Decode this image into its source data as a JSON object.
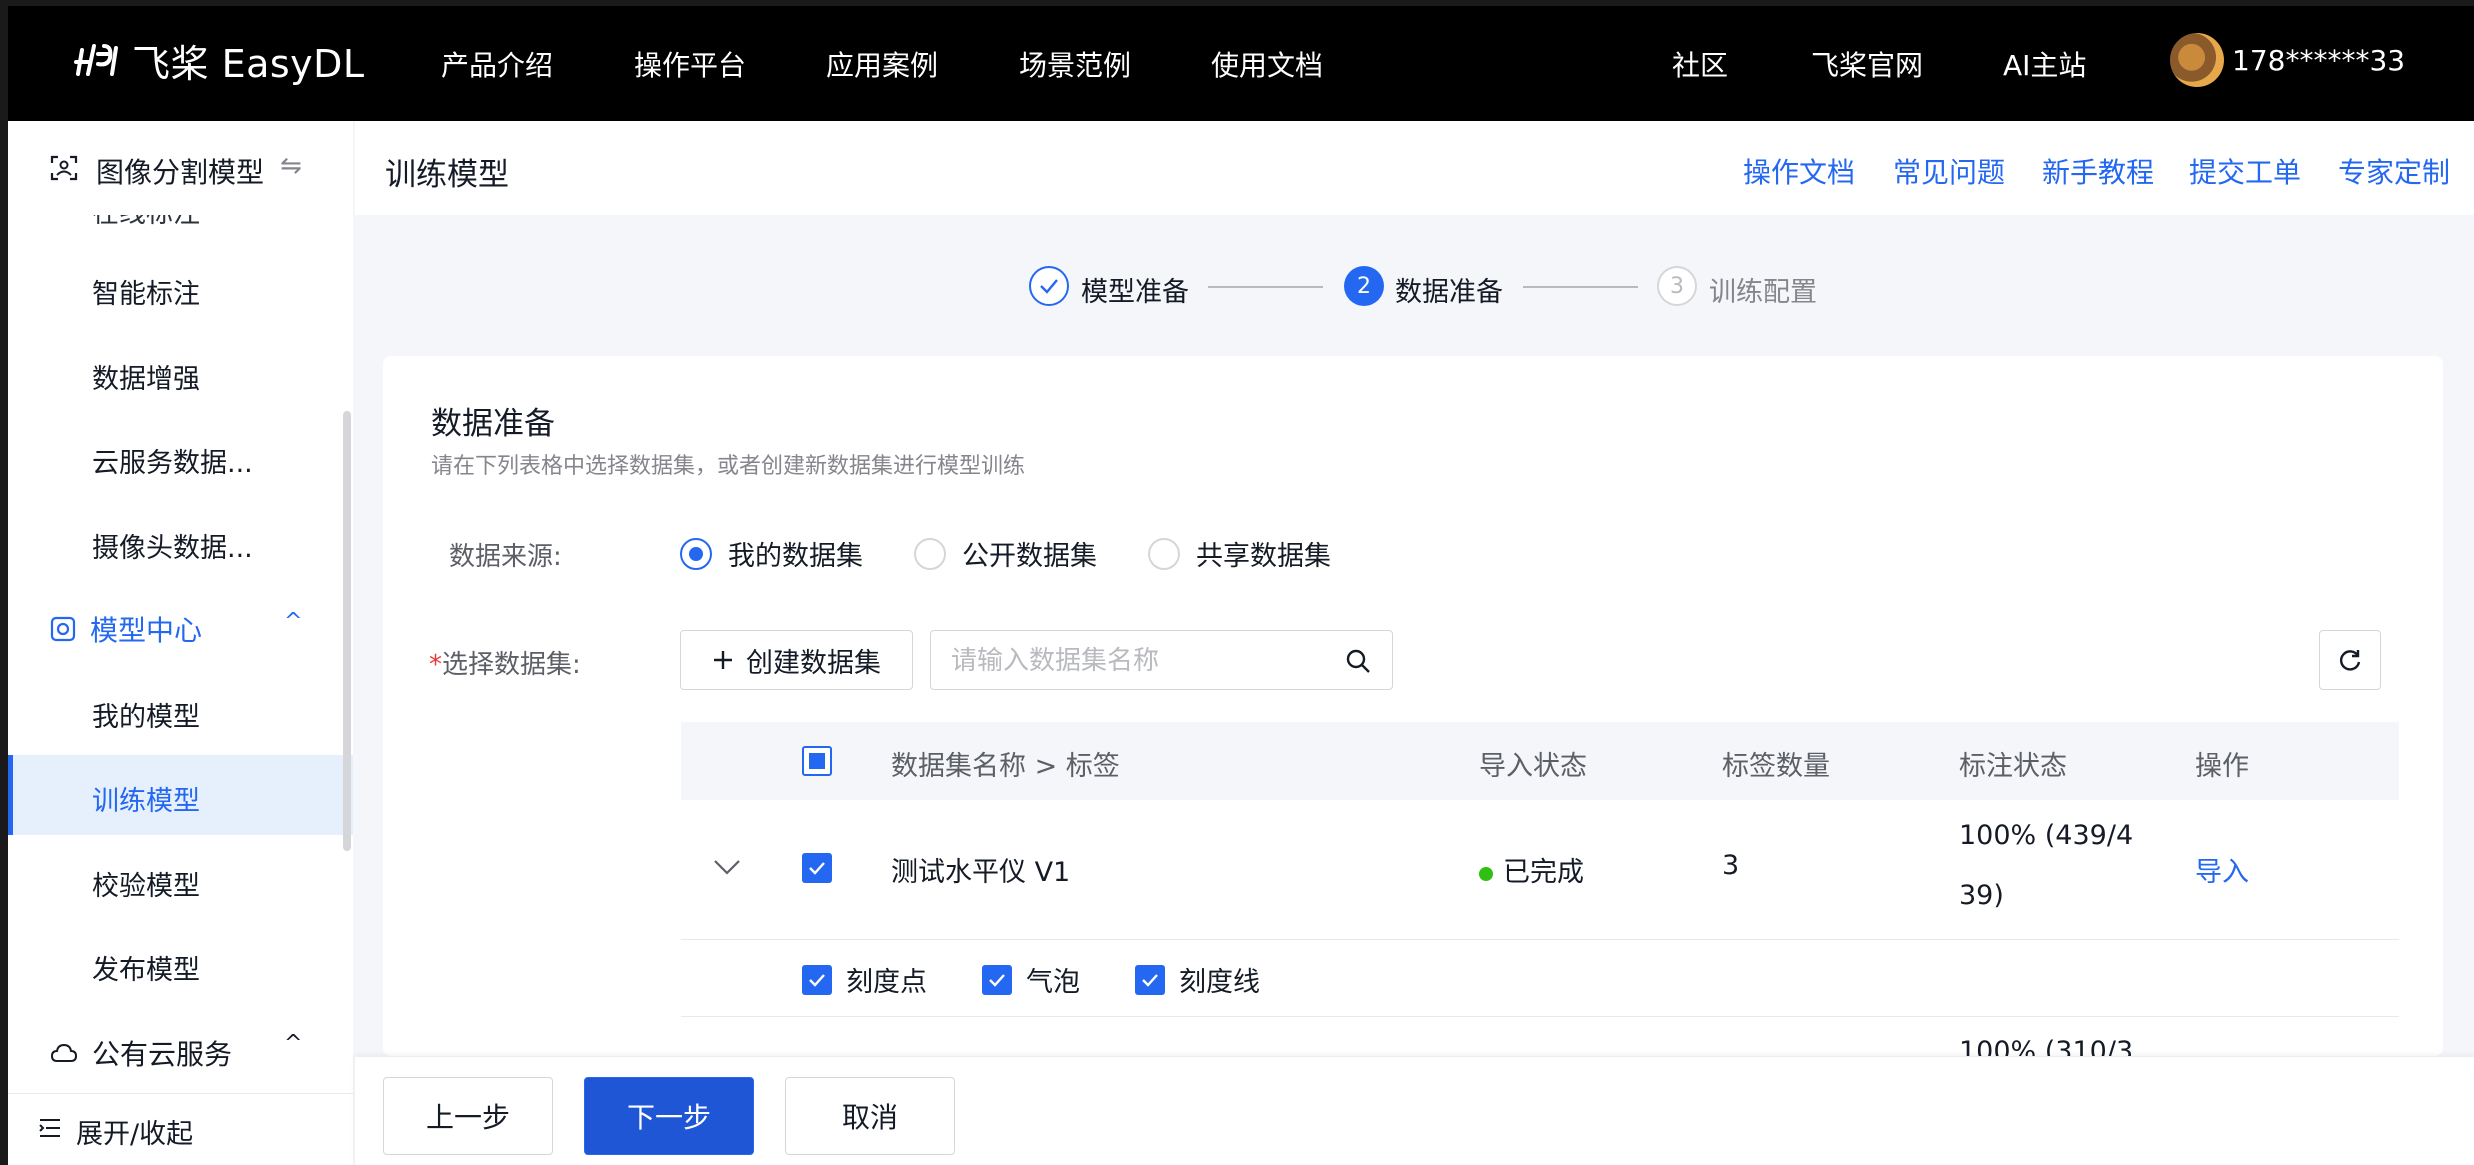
{
  "brand": {
    "logo_text": "飞桨 EasyDL"
  },
  "topnav": {
    "items": [
      "产品介绍",
      "操作平台",
      "应用案例",
      "场景范例",
      "使用文档"
    ],
    "right_items": [
      "社区",
      "飞桨官网",
      "AI主站"
    ],
    "username": "178******33"
  },
  "sidebar": {
    "header": {
      "label": "图像分割模型",
      "switch_icon": "⇋"
    },
    "clipped_item": "在线标注",
    "items": [
      "智能标注",
      "数据增强",
      "云服务数据...",
      "摄像头数据..."
    ],
    "model_center": {
      "label": "模型中心",
      "items": [
        "我的模型",
        "训练模型",
        "校验模型",
        "发布模型"
      ],
      "active": "训练模型"
    },
    "public_cloud": {
      "label": "公有云服务"
    },
    "footer": {
      "label": "展开/收起"
    }
  },
  "page": {
    "title": "训练模型",
    "header_links": [
      "操作文档",
      "常见问题",
      "新手教程",
      "提交工单",
      "专家定制"
    ]
  },
  "steps": [
    {
      "index": "1",
      "label": "模型准备",
      "state": "done"
    },
    {
      "index": "2",
      "label": "数据准备",
      "state": "active"
    },
    {
      "index": "3",
      "label": "训练配置",
      "state": "pending"
    }
  ],
  "card": {
    "title": "数据准备",
    "subtitle": "请在下列表格中选择数据集，或者创建新数据集进行模型训练",
    "source_label": "数据来源:",
    "source_options": [
      {
        "label": "我的数据集",
        "selected": true
      },
      {
        "label": "公开数据集",
        "selected": false
      },
      {
        "label": "共享数据集",
        "selected": false
      }
    ],
    "select_label": "选择数据集:",
    "create_button": "创建数据集",
    "search_placeholder": "请输入数据集名称"
  },
  "table": {
    "headers": [
      "数据集名称 > 标签",
      "导入状态",
      "标签数量",
      "标注状态",
      "操作"
    ],
    "rows": [
      {
        "name": "测试水平仪 V1",
        "import_status": "已完成",
        "label_count": "3",
        "annotation_status_line1": "100% (439/4",
        "annotation_status_line2": "39)",
        "action": "导入",
        "tags": [
          "刻度点",
          "气泡",
          "刻度线"
        ]
      },
      {
        "annotation_status_line1": "100% (310/3"
      }
    ]
  },
  "footer": {
    "prev": "上一步",
    "next": "下一步",
    "cancel": "取消"
  },
  "colors": {
    "accent": "#2468f2",
    "nav_bg": "#000000",
    "success": "#30bf13",
    "required": "#e8363a"
  }
}
